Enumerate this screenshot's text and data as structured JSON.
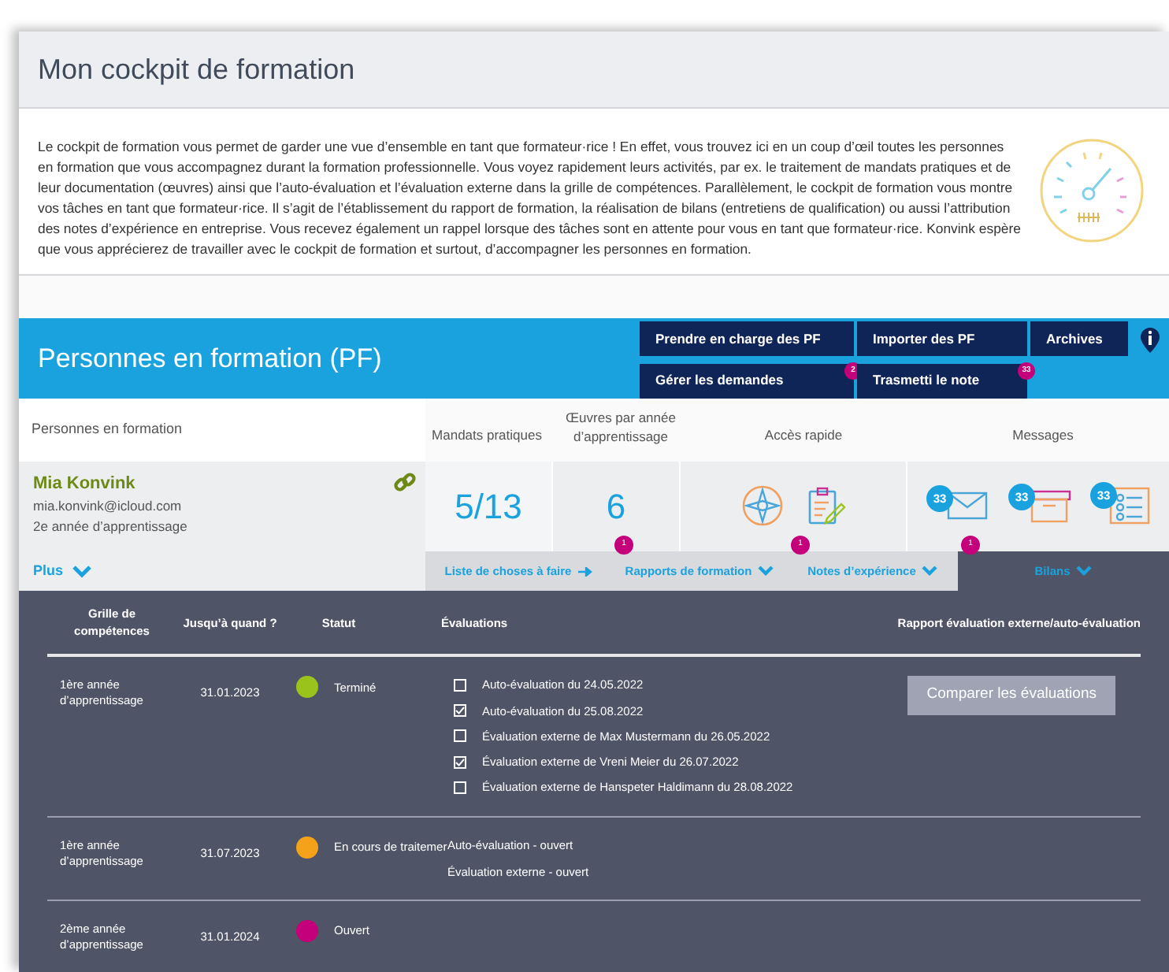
{
  "header": {
    "title": "Mon cockpit de formation"
  },
  "intro": "Le cockpit de formation vous permet de garder une vue d’ensemble en tant que formateur·rice ! En effet, vous trouvez ici en un coup d’œil toutes les personnes en formation que vous accompagnez durant la formation professionnelle. Vous voyez rapidement leurs activités, par ex. le traitement de mandats pratiques et de leur documentation (œuvres) ainsi que l’auto-évaluation et l’évaluation externe dans la grille de compétences. Parallèlement, le cockpit de formation vous montre vos tâches en tant que formateur·rice. Il s’agit de l’établissement du rapport de formation, la réalisation de bilans (entretiens de qualification) ou aussi l’attribution des notes d’expérience en entreprise. Vous recevez également un rappel lorsque des tâches sont en attente pour vous en tant que formateur·rice. Konvink espère que vous apprécierez de travailler avec le cockpit de formation et surtout, d’accompagner les personnes en formation.",
  "section": {
    "title": "Personnes en formation (PF)",
    "buttons": [
      {
        "label": "Prendre en charge des PF"
      },
      {
        "label": "Importer des PF"
      },
      {
        "label": "Archives"
      },
      {
        "label": "Gérer les demandes",
        "badge": "2"
      },
      {
        "label": "Trasmetti le note",
        "badge": "33"
      }
    ]
  },
  "columns": [
    "Personnes en formation",
    "Mandats pratiques",
    "Œuvres par année d’apprentissage",
    "Accès rapide",
    "Messages"
  ],
  "person": {
    "name": "Mia Konvink",
    "email": "mia.konvink@icloud.com",
    "year": "2e année d’apprentissage",
    "more": "Plus",
    "mandates": "5/13",
    "works": "6",
    "messages": [
      {
        "badge": "33"
      },
      {
        "badge": "33"
      },
      {
        "badge": "33"
      }
    ]
  },
  "tabs": [
    {
      "label": "Liste de choses à faire",
      "kind": "arrow",
      "selected": false
    },
    {
      "label": "Rapports de formation",
      "kind": "chevron",
      "badge": "1",
      "selected": false
    },
    {
      "label": "Notes d’expérience",
      "kind": "chevron",
      "badge": "1",
      "selected": false
    },
    {
      "label": "Bilans",
      "kind": "chevron",
      "badge": "1",
      "selected": true
    }
  ],
  "table": {
    "columns": [
      "Grille de compétences",
      "Jusqu’à quand ?",
      "Statut",
      "Évaluations",
      "Rapport évaluation externe/auto-évaluation"
    ],
    "rows": [
      {
        "grid": "1ère année d’apprentissage",
        "until": "31.01.2023",
        "status": "Terminé",
        "color": "#9ac31c",
        "evaluations": [
          {
            "label": "Auto-évaluation du 24.05.2022",
            "checked": false
          },
          {
            "label": "Auto-évaluation du 25.08.2022",
            "checked": true
          },
          {
            "label": "Évaluation externe de Max Mustermann du 26.05.2022",
            "checked": false
          },
          {
            "label": "Évaluation externe de Vreni Meier du 26.07.2022",
            "checked": true
          },
          {
            "label": "Évaluation externe de Hanspeter Haldimann du 28.08.2022",
            "checked": false
          }
        ],
        "action": "Comparer les évaluations"
      },
      {
        "grid": "1ère année d’apprentissage",
        "until": "31.07.2023",
        "status": "En cours de traitemer",
        "color": "#f5a21b",
        "notes": [
          "Auto-évaluation - ouvert",
          "Évaluation externe - ouvert"
        ]
      },
      {
        "grid": "2ème année d’apprentissage",
        "until": "31.01.2024",
        "status": "Ouvert",
        "color": "#c4007a"
      }
    ]
  }
}
